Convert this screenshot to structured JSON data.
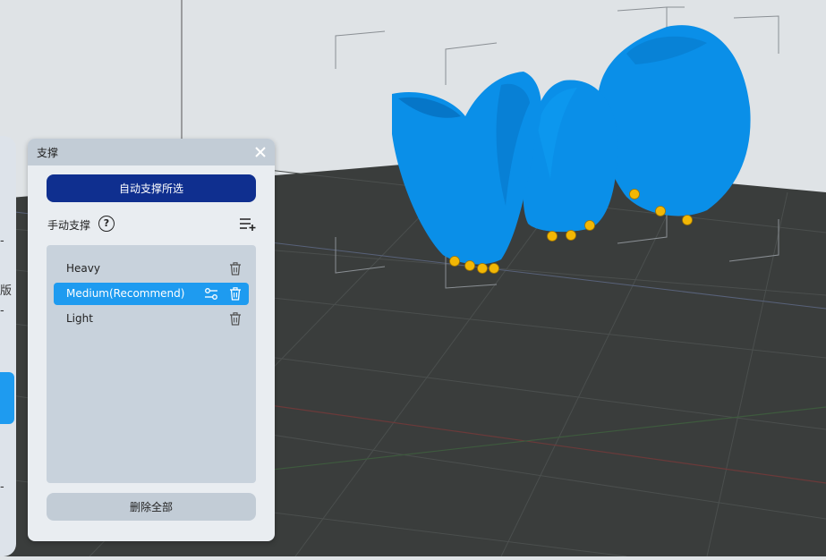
{
  "scene": {
    "background_color": "#dfe3e6",
    "floor_color": "#3a3d3c",
    "model_color": "#0a8fe8",
    "support_color": "#f2b705"
  },
  "left_toolbar": {
    "partial_glyph": "版"
  },
  "support_panel": {
    "title": "支撑",
    "close_icon": "close-icon",
    "auto_support_label": "自动支撑所选",
    "manual_support_label": "手动支撑",
    "help_icon_glyph": "?",
    "presets": [
      {
        "label": "Heavy",
        "selected": false
      },
      {
        "label": "Medium(Recommend)",
        "selected": true
      },
      {
        "label": "Light",
        "selected": false
      }
    ],
    "delete_all_label": "删除全部",
    "accent_color": "#1e9bf0",
    "primary_button_color": "#0f2f8f"
  }
}
